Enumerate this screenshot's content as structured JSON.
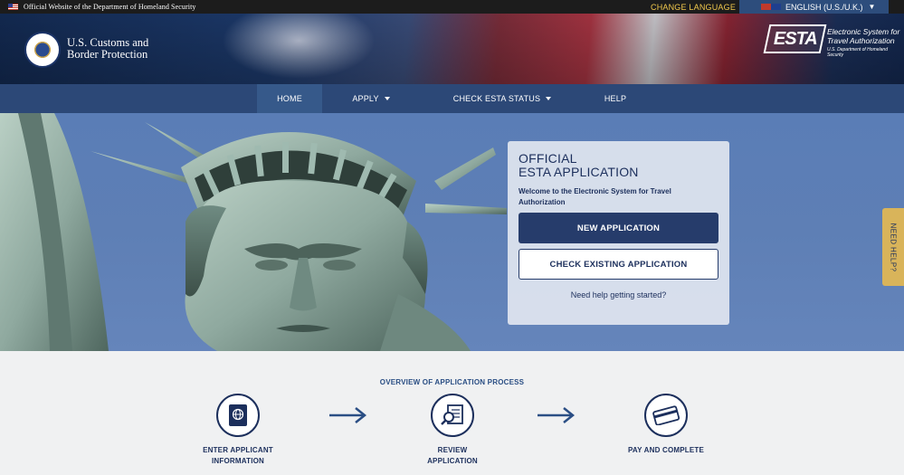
{
  "topbar": {
    "official_text": "Official Website of the Department of Homeland Security",
    "change_language": "CHANGE LANGUAGE",
    "language": "ENGLISH (U.S./U.K.)"
  },
  "header": {
    "agency_line1": "U.S. Customs and",
    "agency_line2": "Border Protection",
    "esta_logo": "ESTA",
    "esta_line1": "Electronic System for",
    "esta_line2": "Travel Authorization",
    "esta_sub": "U.S. Department of Homeland Security"
  },
  "nav": {
    "items": [
      {
        "label": "HOME"
      },
      {
        "label": "APPLY"
      },
      {
        "label": "CHECK ESTA STATUS"
      },
      {
        "label": "HELP"
      }
    ]
  },
  "panel": {
    "title_line1": "OFFICIAL",
    "title_line2": "ESTA APPLICATION",
    "welcome": "Welcome to the Electronic System for Travel Authorization",
    "new_application": "NEW APPLICATION",
    "check_existing": "CHECK EXISTING APPLICATION",
    "help_link": "Need help getting started?"
  },
  "need_help": "NEED HELP?",
  "overview": {
    "title": "OVERVIEW OF APPLICATION PROCESS",
    "steps": [
      {
        "line1": "ENTER APPLICANT",
        "line2": "INFORMATION",
        "icon": "passport-icon"
      },
      {
        "line1": "REVIEW",
        "line2": "APPLICATION",
        "icon": "review-document-icon"
      },
      {
        "line1": "PAY AND COMPLETE",
        "line2": "",
        "icon": "credit-card-icon"
      }
    ]
  },
  "colors": {
    "navy": "#1c2f5c",
    "nav_bg": "#2c4877",
    "accent_gold": "#d9b45a",
    "change_language": "#f2c94c"
  }
}
